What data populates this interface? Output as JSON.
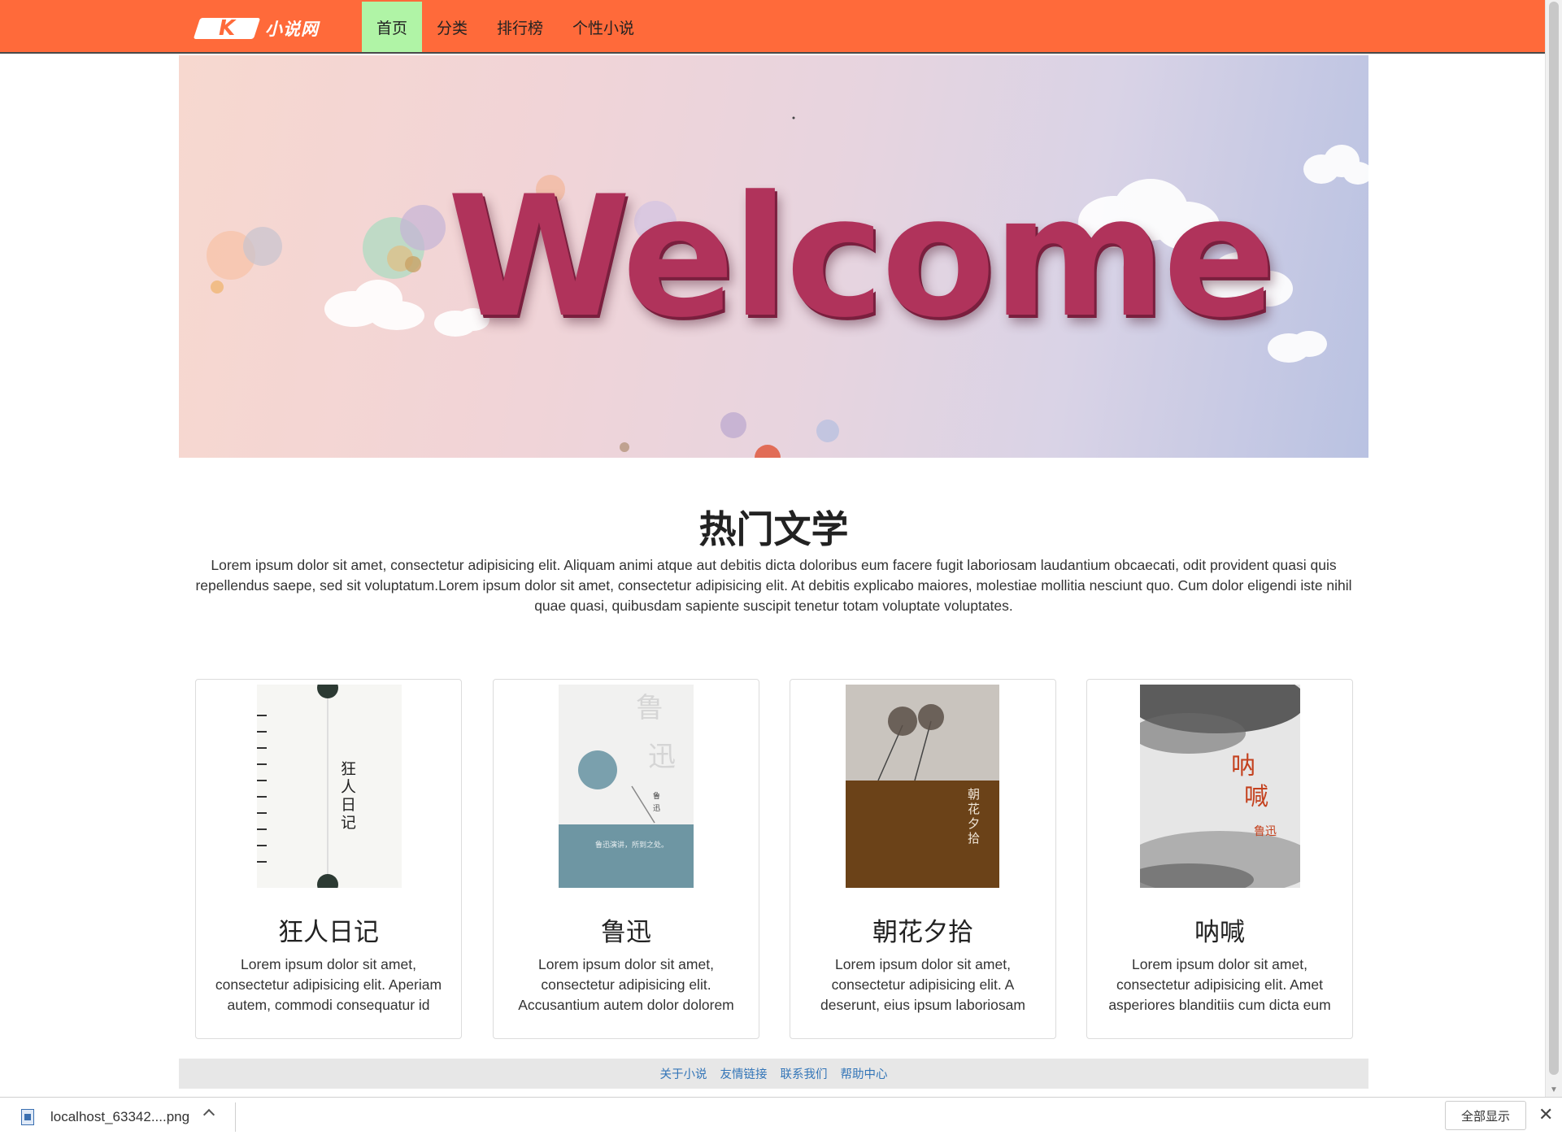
{
  "navbar": {
    "logo_mark": "K",
    "logo_text": "小说网",
    "items": [
      {
        "label": "首页",
        "active": true
      },
      {
        "label": "分类",
        "active": false
      },
      {
        "label": "排行榜",
        "active": false
      },
      {
        "label": "个性小说",
        "active": false
      }
    ],
    "bg_color": "#ff6a3a",
    "active_color": "#b0f4a6"
  },
  "banner": {
    "text": "Welcome"
  },
  "section": {
    "title": "热门文学",
    "description": "Lorem ipsum dolor sit amet, consectetur adipisicing elit. Aliquam animi atque aut debitis dicta doloribus eum facere fugit laboriosam laudantium obcaecati, odit provident quasi quis repellendus saepe, sed sit voluptatum.Lorem ipsum dolor sit amet, consectetur adipisicing elit. At debitis explicabo maiores, molestiae mollitia nesciunt quo. Cum dolor eligendi iste nihil quae quasi, quibusdam sapiente suscipit tenetur totam voluptate voluptates."
  },
  "books": [
    {
      "title": "狂人日记",
      "cover_text": "狂人日记",
      "desc": "Lorem ipsum dolor sit amet, consectetur adipisicing elit. Aperiam autem, commodi consequatur id"
    },
    {
      "title": "鲁迅",
      "cover_text": "鲁迅",
      "desc": "Lorem ipsum dolor sit amet, consectetur adipisicing elit. Accusantium autem dolor dolorem"
    },
    {
      "title": "朝花夕拾",
      "cover_text": "朝花夕拾",
      "desc": "Lorem ipsum dolor sit amet, consectetur adipisicing elit. A deserunt, eius ipsum laboriosam"
    },
    {
      "title": "呐喊",
      "cover_text": "呐喊",
      "desc": "Lorem ipsum dolor sit amet, consectetur adipisicing elit. Amet asperiores blanditiis cum dicta eum"
    }
  ],
  "footer": {
    "links": [
      "关于小说",
      "友情链接",
      "联系我们",
      "帮助中心"
    ]
  },
  "download_bar": {
    "file_name": "localhost_63342....png",
    "show_all": "全部显示",
    "close": "✕"
  }
}
